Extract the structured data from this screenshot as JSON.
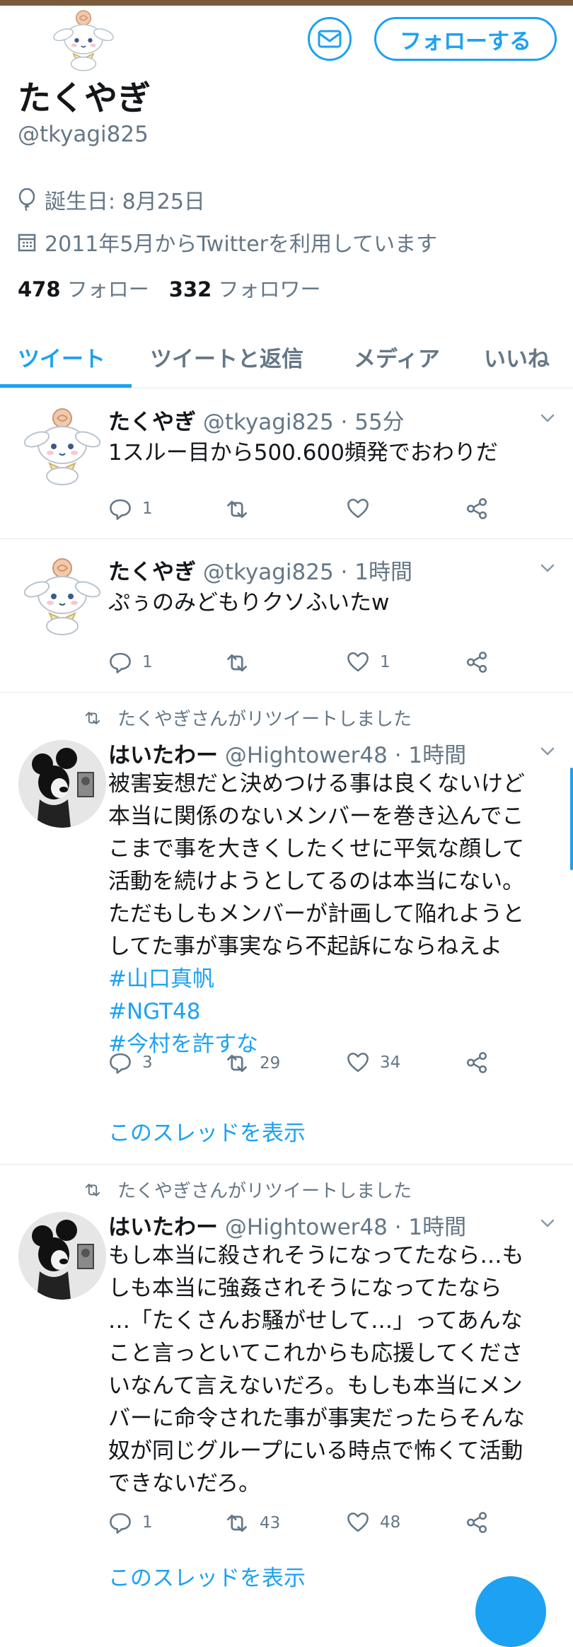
{
  "profile": {
    "name": "たくやぎ",
    "handle": "@tkyagi825",
    "birthday": "誕生日: 8月25日",
    "joined": "2011年5月からTwitterを利用しています",
    "following_count": "478",
    "following_label": "フォロー",
    "followers_count": "332",
    "followers_label": "フォロワー",
    "follow_button": "フォローする"
  },
  "tabs": [
    "ツイート",
    "ツイートと返信",
    "メディア",
    "いいね"
  ],
  "tweets": [
    {
      "name": "たくやぎ",
      "meta": "@tkyagi825 · 55分",
      "lines": [
        "1スルー目から500.600頻発でおわりだ"
      ],
      "reply": "1",
      "retweet": "",
      "like": ""
    },
    {
      "name": "たくやぎ",
      "meta": "@tkyagi825 · 1時間",
      "lines": [
        "ぷぅのみどもりクソふいたw"
      ],
      "reply": "1",
      "retweet": "",
      "like": "1"
    },
    {
      "retweeted_by": "たくやぎさんがリツイートしました",
      "name": "はいたわー",
      "meta": "@Hightower48 · 1時間",
      "lines": [
        "被害妄想だと決めつける事は良くないけど",
        "本当に関係のないメンバーを巻き込んでこ",
        "こまで事を大きくしたくせに平気な顔して",
        "活動を続けようとしてるのは本当にない。",
        "ただもしもメンバーが計画して陥れようと",
        "してた事が事実なら不起訴にならねえよ"
      ],
      "hashtags": [
        "#山口真帆",
        "#NGT48",
        "#今村を許すな"
      ],
      "reply": "3",
      "retweet": "29",
      "like": "34",
      "thread_link": "このスレッドを表示"
    },
    {
      "retweeted_by": "たくやぎさんがリツイートしました",
      "name": "はいたわー",
      "meta": "@Hightower48 · 1時間",
      "lines": [
        "もし本当に殺されそうになってたなら…も",
        "しも本当に強姦されそうになってたなら",
        "…「たくさんお騒がせして…」ってあんな",
        "こと言っといてこれからも応援してくださ",
        "いなんて言えないだろ。もしも本当にメン",
        "バーに命令された事が事実だったらそんな",
        "奴が同じグループにいる時点で怖くて活動",
        "できないだろ。"
      ],
      "reply": "1",
      "retweet": "43",
      "like": "48",
      "thread_link": "このスレッドを表示"
    }
  ],
  "colors": {
    "accent": "#1da1f2",
    "muted": "#657786",
    "text": "#14171a",
    "divider": "#e1e8ed"
  },
  "icons": {
    "mail": "mail-icon",
    "birthday": "balloon-icon",
    "calendar": "calendar-icon",
    "reply": "reply-icon",
    "retweet": "retweet-icon",
    "like": "heart-icon",
    "share": "share-icon",
    "caret": "chevron-down-icon",
    "compose": "compose-icon"
  }
}
